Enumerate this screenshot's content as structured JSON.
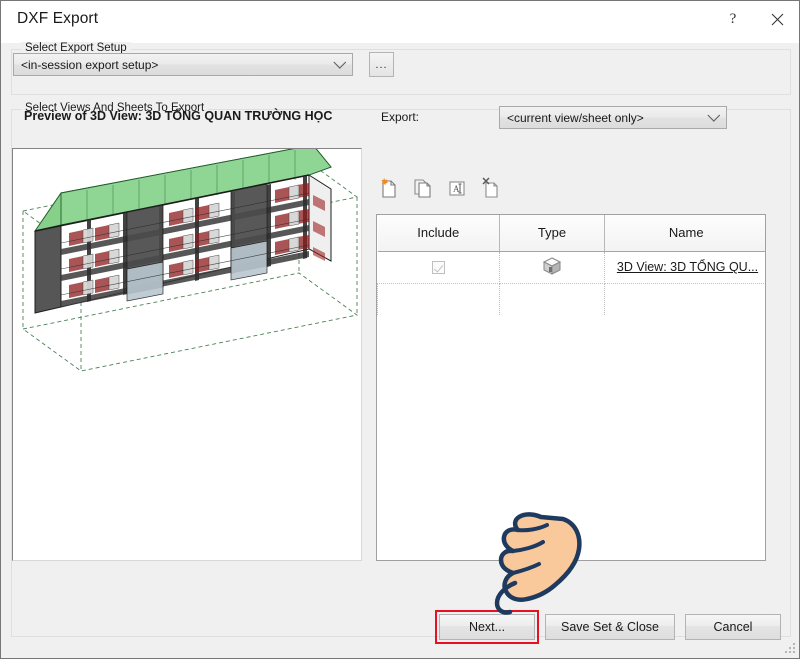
{
  "window": {
    "title": "DXF Export",
    "help_label": "?",
    "close_label": "×"
  },
  "setup_group": {
    "title": "Select Export Setup",
    "combo_value": "<in-session export setup>",
    "browse_label": "..."
  },
  "views_group": {
    "title": "Select Views And Sheets To Export",
    "preview_label": "Preview of 3D View: 3D TỔNG QUAN TRƯỜNG HỌC",
    "export_label": "Export:",
    "export_value": "<current view/sheet only>"
  },
  "toolbar": {
    "items": [
      {
        "name": "new-set-icon",
        "tooltip": "New Set"
      },
      {
        "name": "duplicate-set-icon",
        "tooltip": "Duplicate Set"
      },
      {
        "name": "rename-set-icon",
        "tooltip": "Rename Set"
      },
      {
        "name": "delete-set-icon",
        "tooltip": "Delete Set"
      }
    ]
  },
  "table": {
    "headers": [
      "Include",
      "Type",
      "Name"
    ],
    "rows": [
      {
        "include": true,
        "type_icon": "3d-view-icon",
        "name": "3D View: 3D TỔNG QU..."
      }
    ]
  },
  "footer": {
    "next_label": "Next...",
    "save_label": "Save Set & Close",
    "cancel_label": "Cancel"
  },
  "colors": {
    "highlight": "#e81123",
    "dialog_bg": "#f0f0f0",
    "roof_green": "#86d08a",
    "hand_fill": "#f9c99b",
    "hand_outline": "#1f3a5f"
  }
}
